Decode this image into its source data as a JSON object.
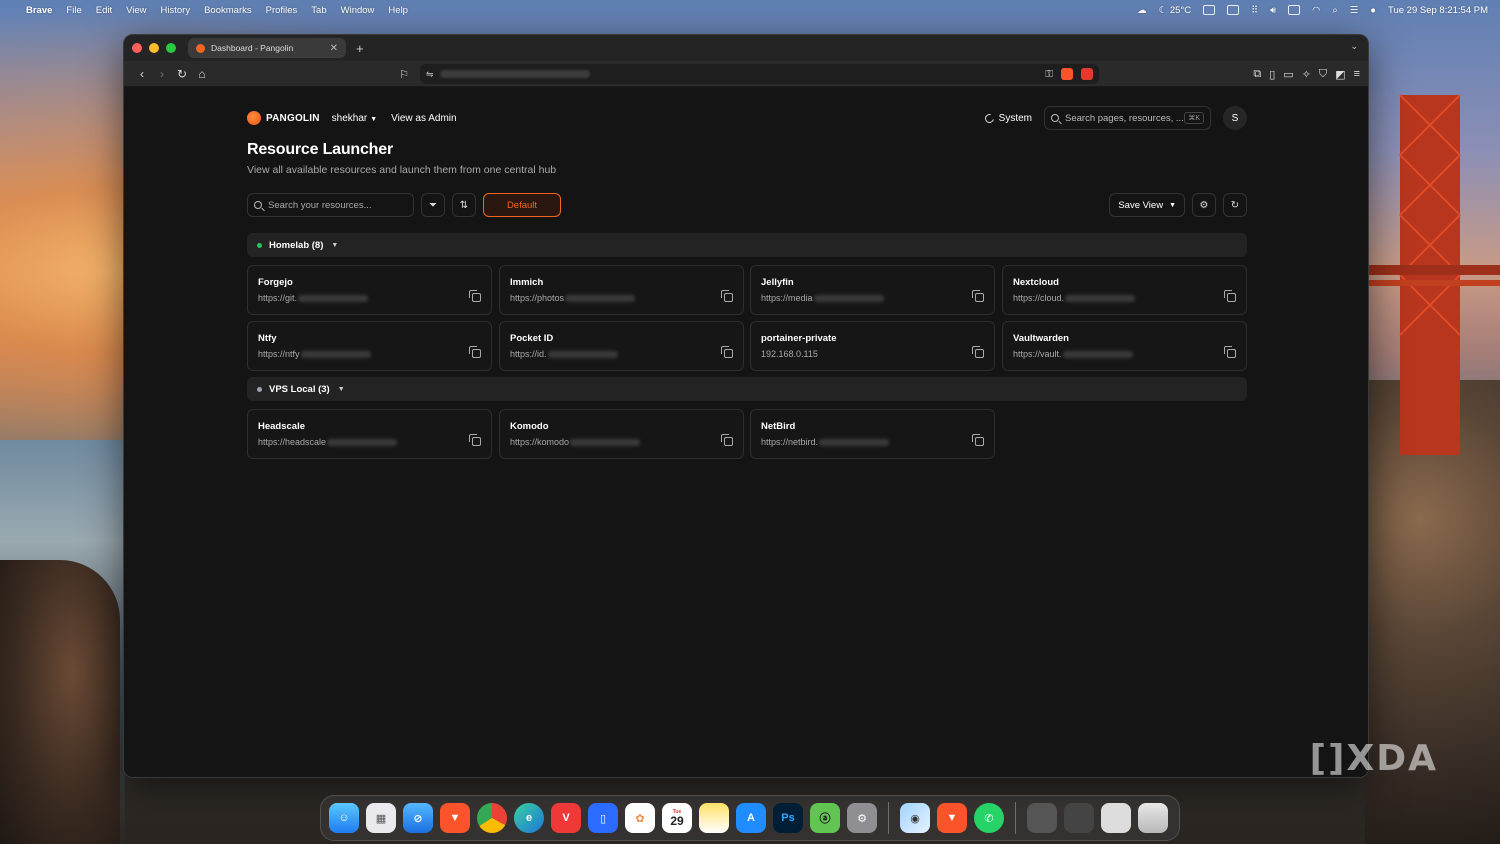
{
  "menubar": {
    "app_name": "Brave",
    "menus": [
      "File",
      "Edit",
      "View",
      "History",
      "Bookmarks",
      "Profiles",
      "Tab",
      "Window",
      "Help"
    ],
    "temperature": "25°C",
    "datetime": "Tue 29 Sep  8:21:54 PM"
  },
  "browser": {
    "tab_title": "Dashboard - Pangolin",
    "new_tab": "+"
  },
  "header": {
    "logo_text": "PANGOLIN",
    "org": "shekhar",
    "view_as_admin": "View as Admin",
    "theme_label": "System",
    "search_placeholder": "Search pages, resources, ...",
    "search_shortcut": "⌘K",
    "avatar_initial": "S"
  },
  "main": {
    "title": "Resource Launcher",
    "subtitle": "View all available resources and launch them from one central hub",
    "search_placeholder": "Search your resources...",
    "default_button": "Default",
    "save_view": "Save View"
  },
  "groups": [
    {
      "label": "Homelab (8)",
      "status_color": "#22c55e",
      "resources": [
        {
          "name": "Forgejo",
          "url": "https://git."
        },
        {
          "name": "Immich",
          "url": "https://photos"
        },
        {
          "name": "Jellyfin",
          "url": "https://media"
        },
        {
          "name": "Nextcloud",
          "url": "https://cloud."
        },
        {
          "name": "Ntfy",
          "url": "https://ntfy"
        },
        {
          "name": "Pocket ID",
          "url": "https://id."
        },
        {
          "name": "portainer-private",
          "url": "192.168.0.115"
        },
        {
          "name": "Vaultwarden",
          "url": "https://vault."
        }
      ]
    },
    {
      "label": "VPS Local (3)",
      "status_color": "#9ca3af",
      "resources": [
        {
          "name": "Headscale",
          "url": "https://headscale"
        },
        {
          "name": "Komodo",
          "url": "https://komodo"
        },
        {
          "name": "NetBird",
          "url": "https://netbird."
        }
      ]
    }
  ],
  "dock": {
    "calendar_day": "29",
    "calendar_weekday": "Tue"
  },
  "watermark": "XDA",
  "colors": {
    "accent": "#f26522",
    "page_bg": "#141414"
  }
}
